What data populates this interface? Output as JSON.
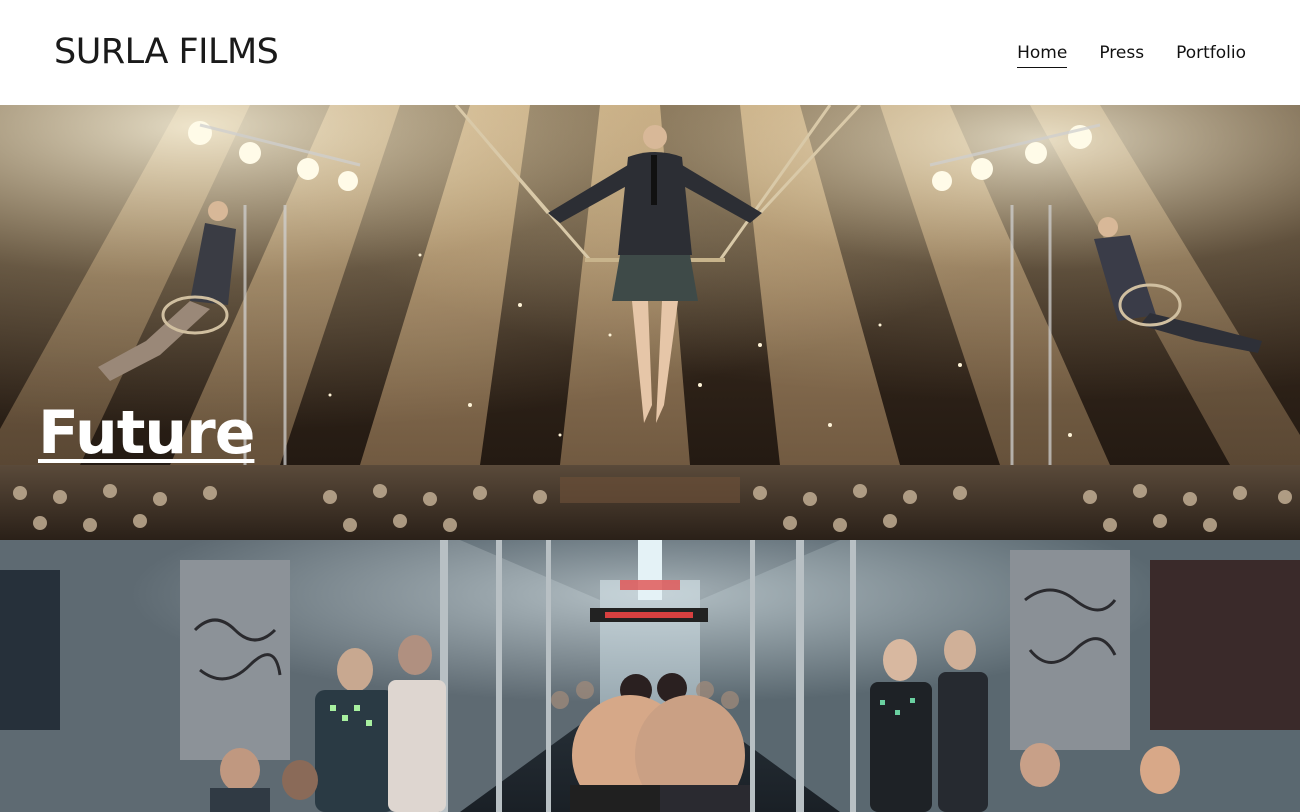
{
  "site": {
    "title": "SURLA FILMS"
  },
  "nav": {
    "items": [
      {
        "label": "Home",
        "active": true
      },
      {
        "label": "Press",
        "active": false
      },
      {
        "label": "Portfolio",
        "active": false
      }
    ]
  },
  "panels": [
    {
      "title": "Future",
      "image": "circus-trapeze-photo"
    },
    {
      "title": "",
      "image": "subway-sumo-photo"
    }
  ],
  "colors": {
    "text": "#111111",
    "background": "#ffffff",
    "overlay_text": "#ffffff"
  }
}
